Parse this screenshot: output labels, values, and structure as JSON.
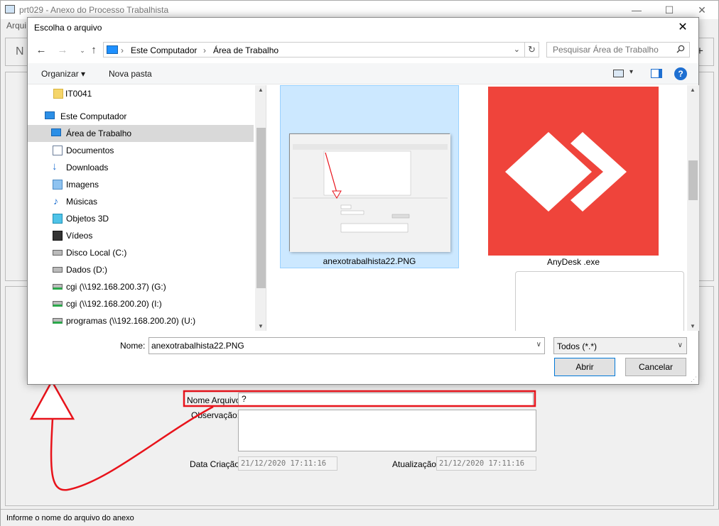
{
  "app": {
    "title": "prt029 - Anexo do Processo Trabalhista",
    "menu_label": "Arqui",
    "minimize": "—",
    "maximize": "☐",
    "close": "✕",
    "toolbar_glyph_left": "N",
    "toolbar_glyph_right": "+",
    "form": {
      "nome_arquivo_label": "Nome Arquivo:",
      "nome_arquivo_value": "?",
      "observacao_label": "Observação:",
      "data_criacao_label": "Data Criação:",
      "data_criacao_value": "21/12/2020 17:11:16",
      "atualizacao_label": "Atualização:",
      "atualizacao_value": "21/12/2020 17:11:16"
    },
    "status_text": "Informe o nome do arquivo do anexo"
  },
  "dialog": {
    "title": "Escolha o arquivo",
    "close": "✕",
    "nav": {
      "back": "←",
      "forward": "→",
      "up": "↑",
      "dropdown": "⌄",
      "refresh": "↻"
    },
    "breadcrumb": [
      "Este Computador",
      "Área de Trabalho"
    ],
    "breadcrumb_sep": "›",
    "search_placeholder": "Pesquisar Área de Trabalho",
    "commands": {
      "organize": "Organizar ▾",
      "new_folder": "Nova pasta",
      "view_dropdown": "▾",
      "help": "?"
    },
    "tree": [
      {
        "label": "IT0041",
        "icon": "folder-icon"
      },
      {
        "label": "Este Computador",
        "icon": "computer-icon"
      },
      {
        "label": "Área de Trabalho",
        "icon": "desktop-icon",
        "selected": true
      },
      {
        "label": "Documentos",
        "icon": "documents-icon"
      },
      {
        "label": "Downloads",
        "icon": "downloads-icon"
      },
      {
        "label": "Imagens",
        "icon": "pictures-icon"
      },
      {
        "label": "Músicas",
        "icon": "music-icon"
      },
      {
        "label": "Objetos 3D",
        "icon": "objects-3d-icon"
      },
      {
        "label": "Vídeos",
        "icon": "videos-icon"
      },
      {
        "label": "Disco Local (C:)",
        "icon": "local-disk-icon"
      },
      {
        "label": "Dados (D:)",
        "icon": "drive-icon"
      },
      {
        "label": "cgi (\\\\192.168.200.37) (G:)",
        "icon": "network-drive-icon"
      },
      {
        "label": "cgi (\\\\192.168.200.20) (I:)",
        "icon": "network-drive-icon"
      },
      {
        "label": "programas (\\\\192.168.200.20) (U:)",
        "icon": "network-drive-icon"
      }
    ],
    "files": [
      {
        "name": "anexotrabalhista22.PNG",
        "selected": true
      },
      {
        "name": "AnyDesk .exe"
      }
    ],
    "name_label": "Nome:",
    "name_value": "anexotrabalhista22.PNG",
    "file_type": "Todos (*.*)",
    "open_button": "Abrir",
    "cancel_button": "Cancelar"
  },
  "colors": {
    "annotation_red": "#e8131b",
    "selection_blue": "#cce8ff",
    "anydesk_red": "#ef443b",
    "help_blue": "#1e6fd1"
  }
}
